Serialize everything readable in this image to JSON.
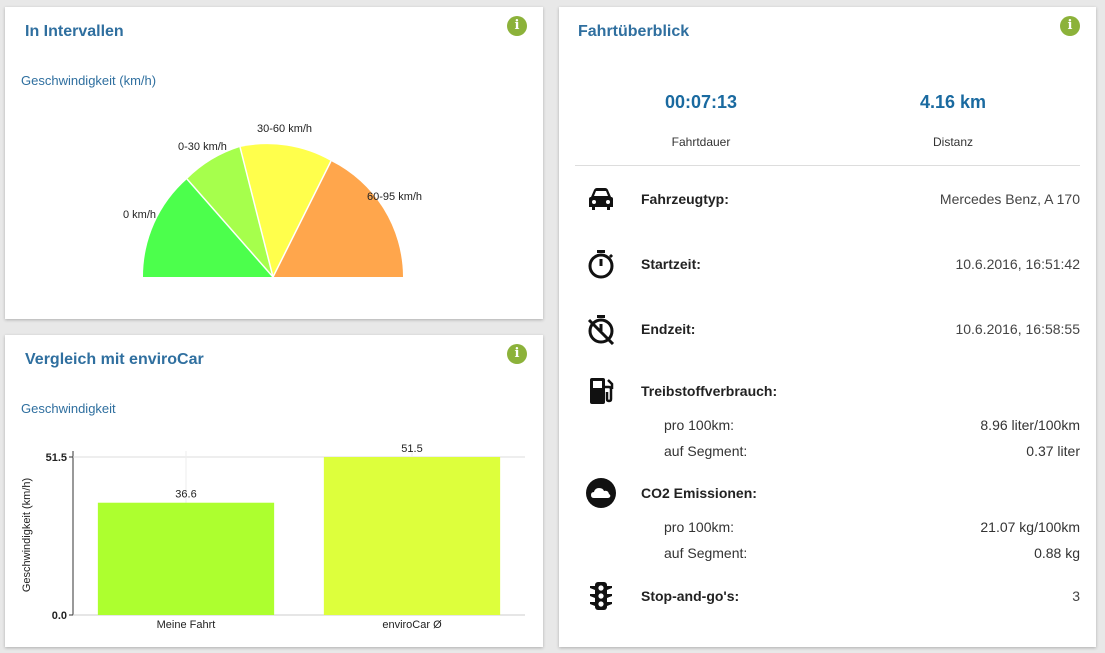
{
  "intervals": {
    "title": "In Intervallen",
    "subtitle": "Geschwindigkeit (km/h)",
    "segments": [
      {
        "label": "0 km/h",
        "color": "#4cff4c"
      },
      {
        "label": "0-30 km/h",
        "color": "#a6ff4c"
      },
      {
        "label": "30-60 km/h",
        "color": "#ffff4c"
      },
      {
        "label": "60-95 km/h",
        "color": "#ffa64c"
      }
    ]
  },
  "compare": {
    "title": "Vergleich mit enviroCar",
    "subtitle": "Geschwindigkeit",
    "chart_data": {
      "type": "bar",
      "categories": [
        "Meine Fahrt",
        "enviroCar Ø"
      ],
      "values": [
        36.6,
        51.5
      ],
      "value_labels": [
        "36.6",
        "51.5"
      ],
      "colors": [
        "#adff2f",
        "#ddff3c"
      ],
      "ylabel": "Geschwindigkeit (km/h)",
      "y_ticks": [
        "0.0",
        "51.5"
      ],
      "ylim": [
        0,
        51.5
      ]
    }
  },
  "overview": {
    "title": "Fahrtüberblick",
    "duration_value": "00:07:13",
    "duration_label": "Fahrtdauer",
    "distance_value": "4.16 km",
    "distance_label": "Distanz",
    "vehicle_label": "Fahrzeugtyp:",
    "vehicle_value": "Mercedes Benz, A 170",
    "start_label": "Startzeit:",
    "start_value": "10.6.2016, 16:51:42",
    "end_label": "Endzeit:",
    "end_value": "10.6.2016, 16:58:55",
    "fuel_label": "Treibstoffverbrauch:",
    "fuel_per100_label": "pro 100km:",
    "fuel_per100_value": "8.96 liter/100km",
    "fuel_segment_label": "auf Segment:",
    "fuel_segment_value": "0.37 liter",
    "co2_label": "CO2 Emissionen:",
    "co2_per100_label": "pro 100km:",
    "co2_per100_value": "21.07 kg/100km",
    "co2_segment_label": "auf Segment:",
    "co2_segment_value": "0.88 kg",
    "stopgo_label": "Stop-and-go's:",
    "stopgo_value": "3"
  },
  "info_icon_glyph": "i"
}
